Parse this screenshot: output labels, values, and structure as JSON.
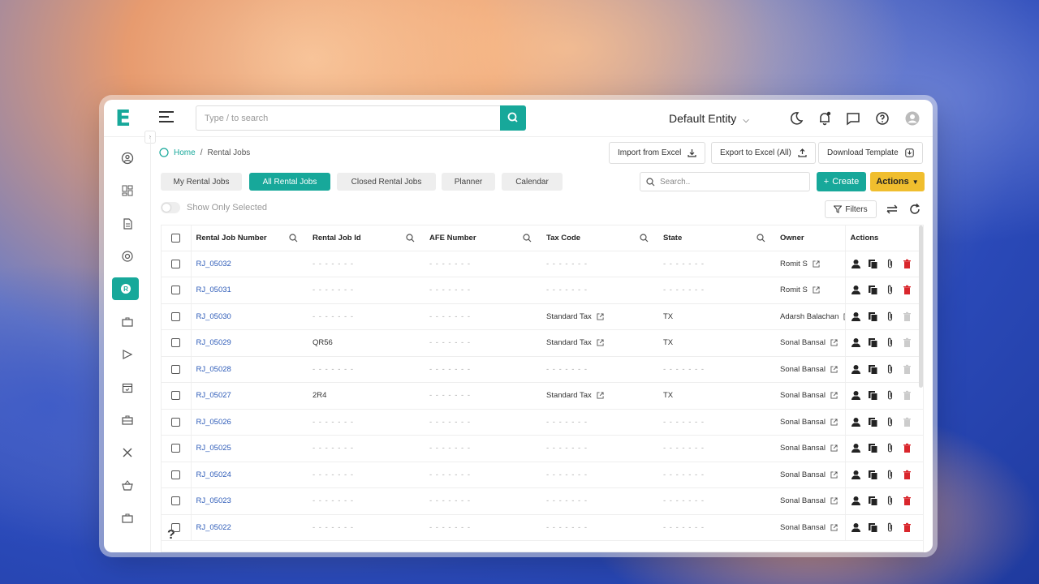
{
  "topbar": {
    "search_placeholder": "Type / to search",
    "entity": "Default Entity"
  },
  "breadcrumb": {
    "home": "Home",
    "separator": "/",
    "current": "Rental Jobs"
  },
  "top_actions": {
    "import": "Import from Excel",
    "export": "Export to Excel (All)",
    "template": "Download Template"
  },
  "tabs": [
    {
      "label": "My Rental Jobs",
      "active": false
    },
    {
      "label": "All Rental Jobs",
      "active": true
    },
    {
      "label": "Closed Rental Jobs",
      "active": false
    },
    {
      "label": "Planner",
      "active": false
    },
    {
      "label": "Calendar",
      "active": false
    }
  ],
  "table_search_placeholder": "Search..",
  "create_label": "Create",
  "actions_label": "Actions",
  "show_only_selected": "Show Only Selected",
  "filters_label": "Filters",
  "columns": [
    "Rental Job Number",
    "Rental Job Id",
    "AFE Number",
    "Tax Code",
    "State",
    "Owner",
    "Actions"
  ],
  "rows": [
    {
      "number": "RJ_05032",
      "job_id": "-------",
      "afe": "-------",
      "tax": "-------",
      "state": "-------",
      "owner": "Romit S",
      "deletable": true
    },
    {
      "number": "RJ_05031",
      "job_id": "-------",
      "afe": "-------",
      "tax": "-------",
      "state": "-------",
      "owner": "Romit S",
      "deletable": true
    },
    {
      "number": "RJ_05030",
      "job_id": "-------",
      "afe": "-------",
      "tax": "Standard Tax",
      "state": "TX",
      "owner": "Adarsh Balachan",
      "deletable": false
    },
    {
      "number": "RJ_05029",
      "job_id": "QR56",
      "afe": "-------",
      "tax": "Standard Tax",
      "state": "TX",
      "owner": "Sonal Bansal",
      "deletable": false
    },
    {
      "number": "RJ_05028",
      "job_id": "-------",
      "afe": "-------",
      "tax": "-------",
      "state": "-------",
      "owner": "Sonal Bansal",
      "deletable": false
    },
    {
      "number": "RJ_05027",
      "job_id": "2R4",
      "afe": "-------",
      "tax": "Standard Tax",
      "state": "TX",
      "owner": "Sonal Bansal",
      "deletable": false
    },
    {
      "number": "RJ_05026",
      "job_id": "-------",
      "afe": "-------",
      "tax": "-------",
      "state": "-------",
      "owner": "Sonal Bansal",
      "deletable": false
    },
    {
      "number": "RJ_05025",
      "job_id": "-------",
      "afe": "-------",
      "tax": "-------",
      "state": "-------",
      "owner": "Sonal Bansal",
      "deletable": true
    },
    {
      "number": "RJ_05024",
      "job_id": "-------",
      "afe": "-------",
      "tax": "-------",
      "state": "-------",
      "owner": "Sonal Bansal",
      "deletable": true
    },
    {
      "number": "RJ_05023",
      "job_id": "-------",
      "afe": "-------",
      "tax": "-------",
      "state": "-------",
      "owner": "Sonal Bansal",
      "deletable": true
    },
    {
      "number": "RJ_05022",
      "job_id": "-------",
      "afe": "-------",
      "tax": "-------",
      "state": "-------",
      "owner": "Sonal Bansal",
      "deletable": true
    }
  ],
  "colors": {
    "accent": "#17a89a",
    "actions": "#f0be2e",
    "link": "#2d5bb8",
    "delete": "#d9262c"
  }
}
